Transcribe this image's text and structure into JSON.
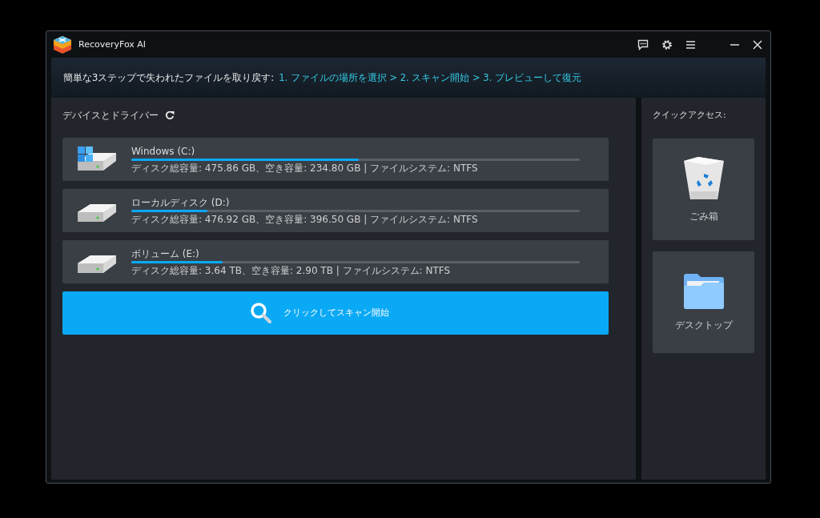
{
  "window": {
    "title": "RecoveryFox AI"
  },
  "banner": {
    "intro": "簡単な3ステップで失われたファイルを取り戻す:",
    "steps": "1. ファイルの場所を選択 > 2. スキャン開始 > 3. プレビューして復元"
  },
  "devices": {
    "heading": "デバイスとドライバー",
    "drives": [
      {
        "kind": "system",
        "name": "Windows (C:)",
        "level": 0.507,
        "details": "ディスク総容量: 475.86 GB、空き容量: 234.80 GB | ファイルシステム: NTFS"
      },
      {
        "kind": "disk",
        "name": "ローカルディスク (D:)",
        "level": 0.169,
        "details": "ディスク総容量: 476.92 GB、空き容量: 396.50 GB | ファイルシステム: NTFS"
      },
      {
        "kind": "disk",
        "name": "ボリューム (E:)",
        "level": 0.203,
        "details": "ディスク総容量: 3.64 TB、空き容量: 2.90 TB | ファイルシステム: NTFS"
      }
    ],
    "scan_button": "クリックしてスキャン開始"
  },
  "quick_access": {
    "heading": "クイックアクセス:",
    "items": [
      {
        "kind": "trash",
        "label": "ごみ箱"
      },
      {
        "kind": "folder",
        "label": "デスクトップ"
      }
    ]
  }
}
